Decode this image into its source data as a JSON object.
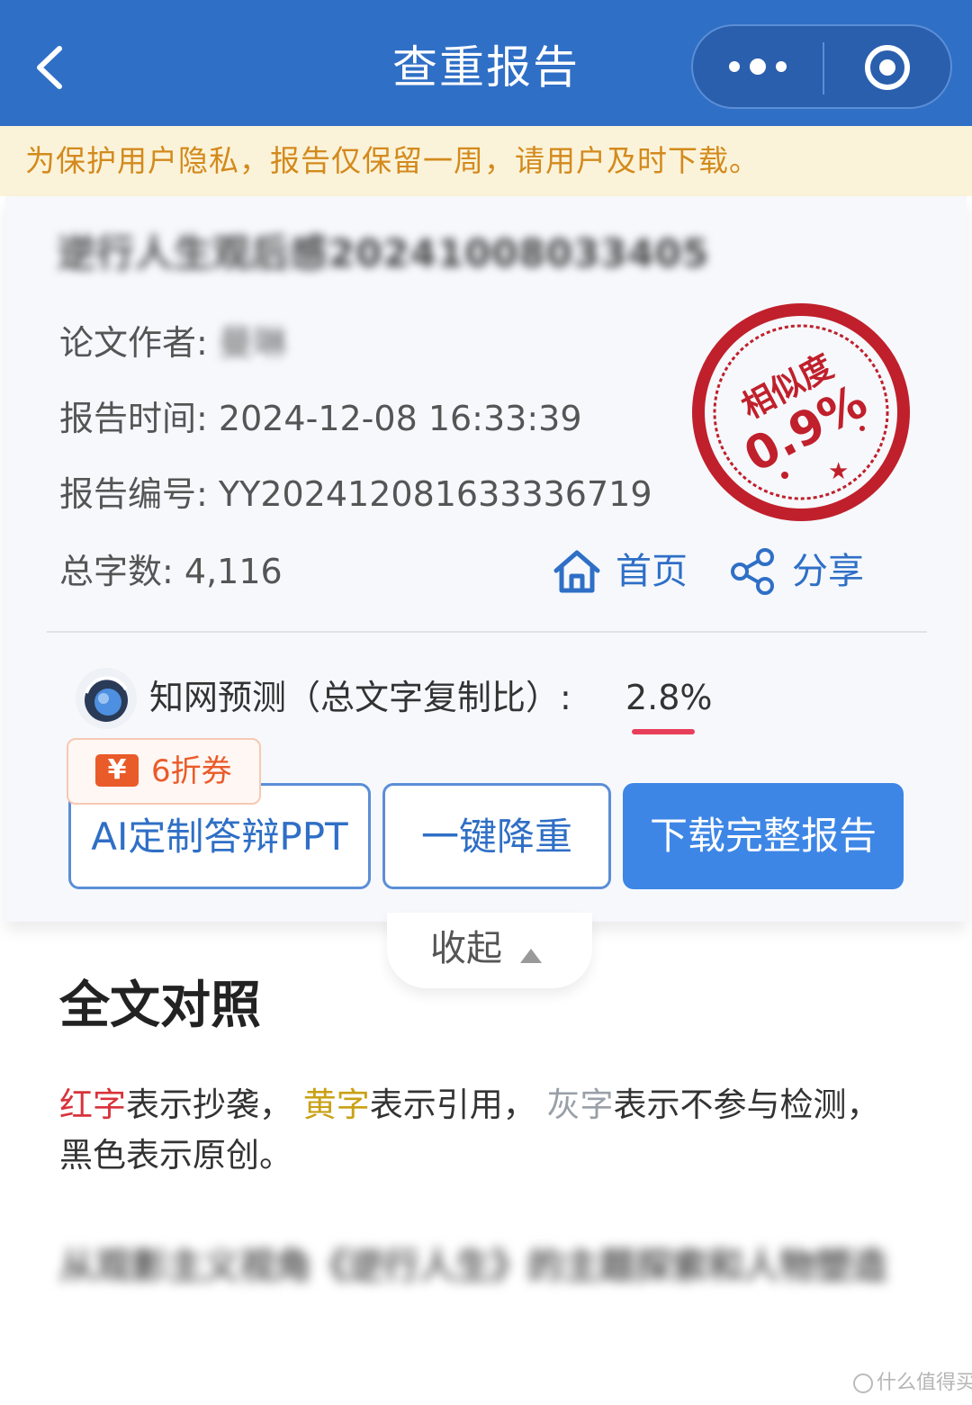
{
  "header": {
    "title": "查重报告"
  },
  "notice": {
    "text": "为保护用户隐私，报告仅保留一周，请用户及时下载。"
  },
  "report": {
    "doc_title": "逆行人生观后感20241008033405",
    "author_label": "论文作者:",
    "author_value": "曼琳",
    "time_label": "报告时间:",
    "time_value": "2024-12-08 16:33:39",
    "id_label": "报告编号:",
    "id_value": "YY20241208163333​6719",
    "words_label": "总字数:",
    "words_value": "4,116",
    "stamp": {
      "label": "相似度",
      "value": "0.9%",
      "similarity_percent": 0.9,
      "color": "#c0202b"
    },
    "home_label": "首页",
    "share_label": "分享"
  },
  "prediction": {
    "label": "知网预测（总文字复制比）:",
    "value": "2.8%"
  },
  "coupon": {
    "icon": "¥",
    "label": "6折券"
  },
  "buttons": {
    "ppt": "AI定制答辩PPT",
    "reduce": "一键降重",
    "download": "下载完整报告"
  },
  "collapse": {
    "label": "收起"
  },
  "section": {
    "title": "全文对照",
    "legend_red": "红字",
    "legend_red_text": "表示抄袭，",
    "legend_yellow": "黄字",
    "legend_yellow_text": "表示引用，",
    "legend_gray": "灰字",
    "legend_gray_text": "表示不参与检测，",
    "legend_black_text": "黑色表示原创。",
    "paragraph": "从观影主义视角《逆行人生》的主题探索和人物塑造"
  },
  "watermark": {
    "text": "什么值得买"
  },
  "colors": {
    "primary": "#2f6fc6",
    "accent_button": "#3d86e6",
    "notice_bg": "#fbf3d9",
    "notice_text": "#d38a1d",
    "underline": "#e83e5a"
  }
}
